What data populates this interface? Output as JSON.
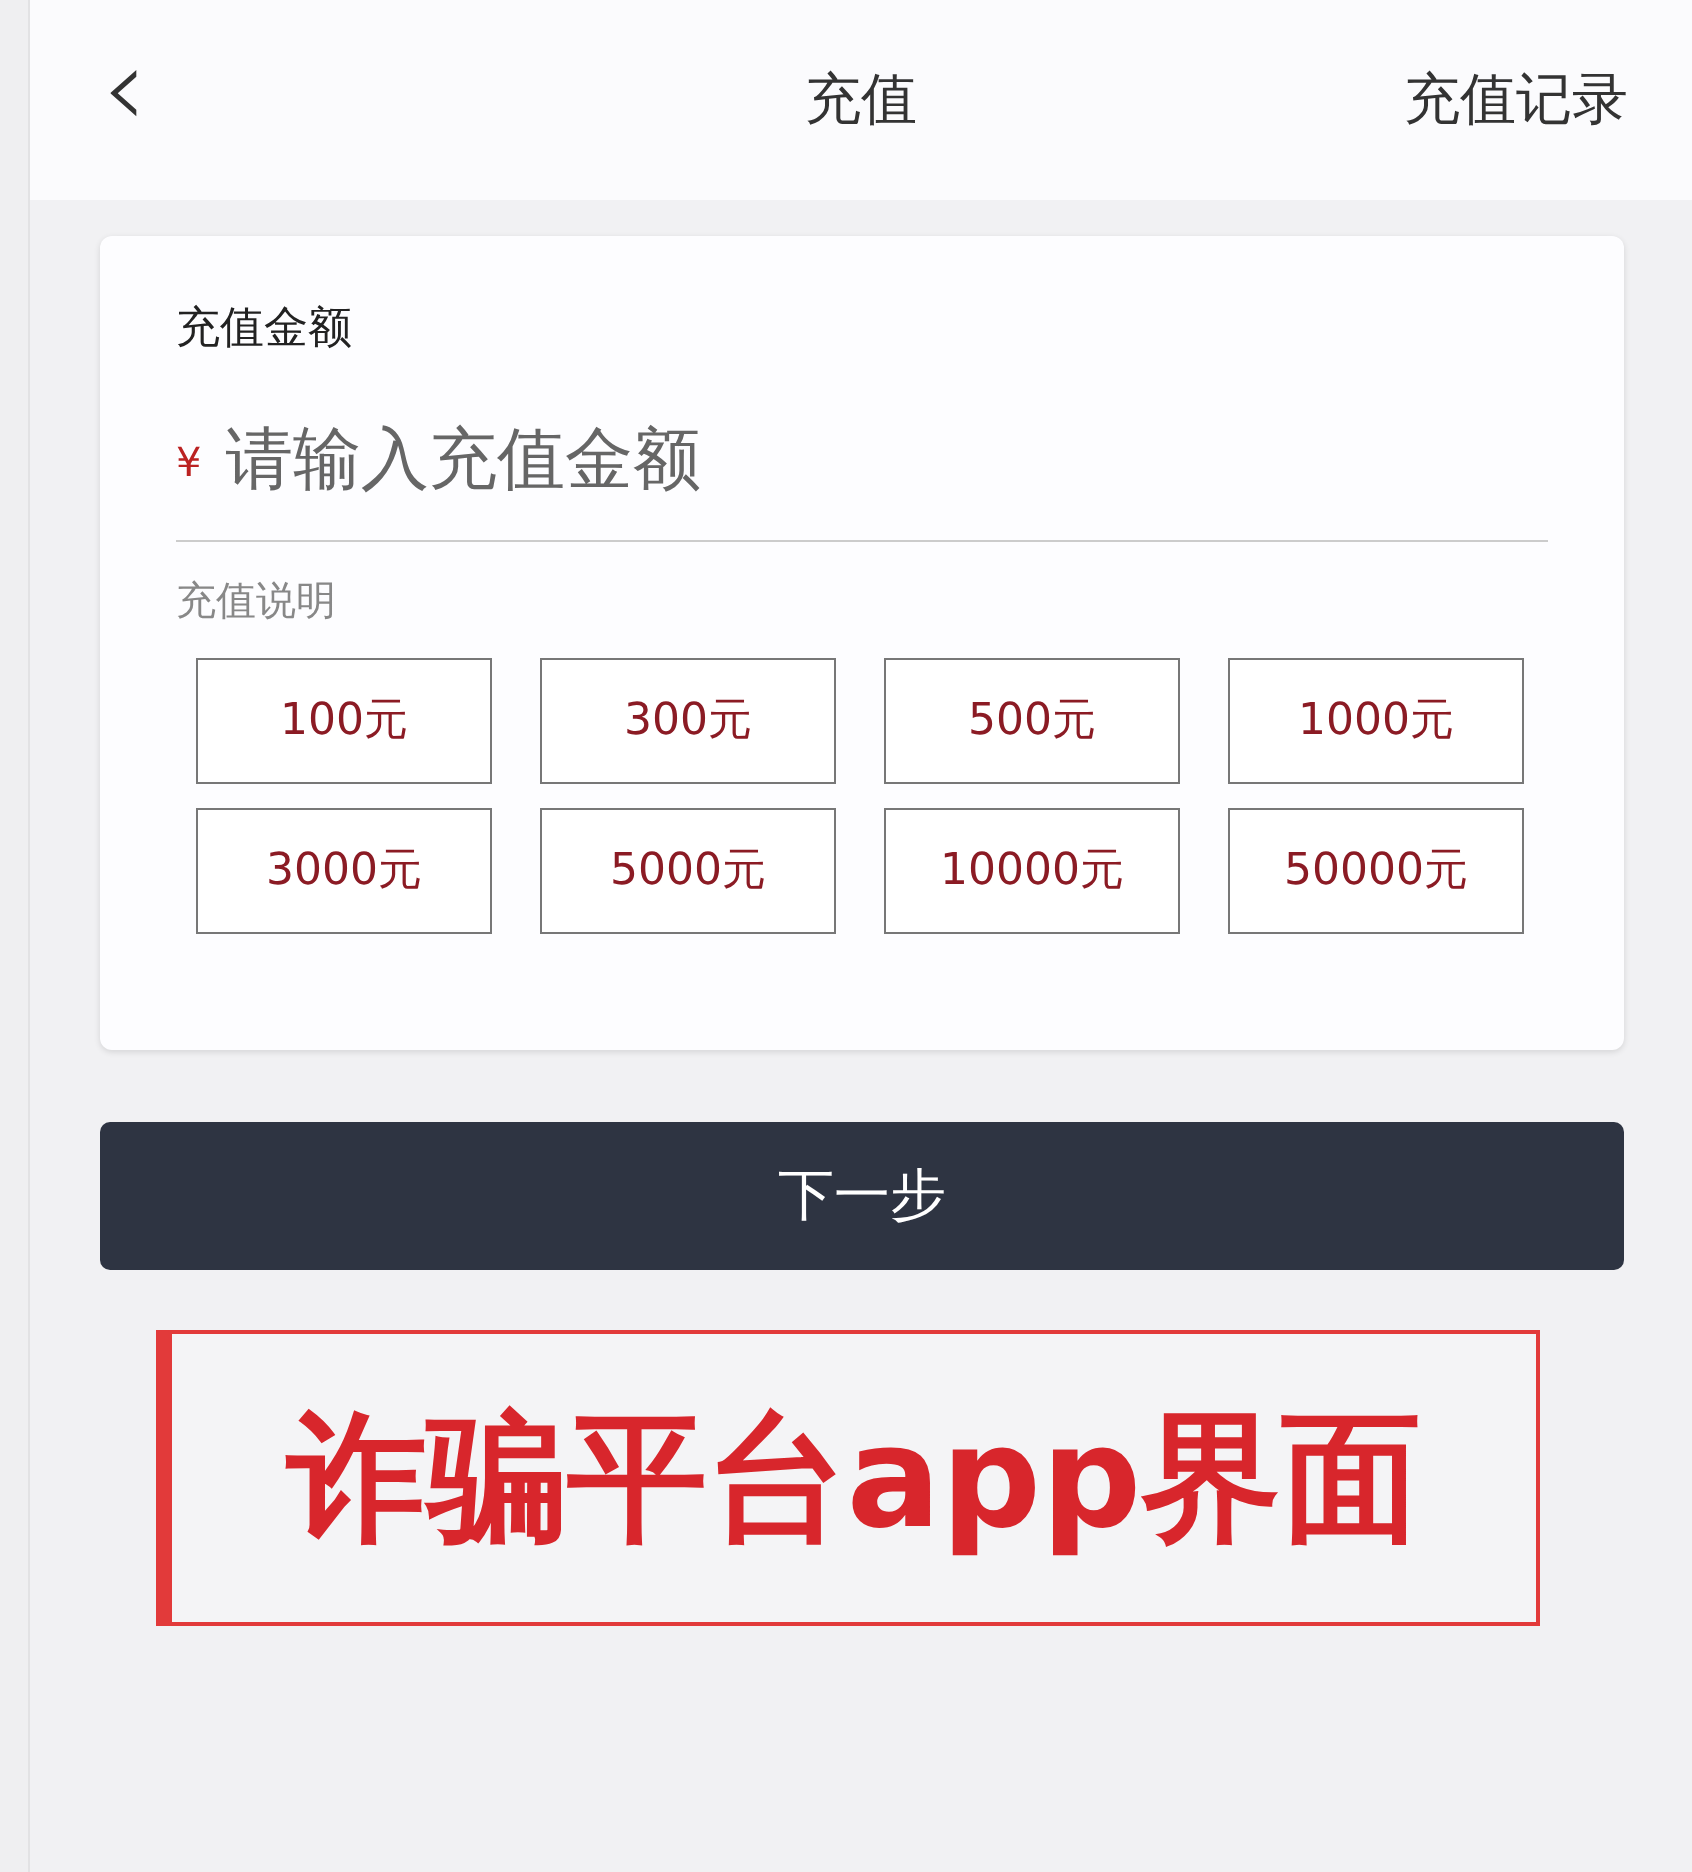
{
  "header": {
    "back_icon": "‹",
    "title": "充值",
    "action": "充值记录"
  },
  "card": {
    "amount_label": "充值金额",
    "currency": "¥",
    "amount_field": {
      "placeholder": "请输入充值金额"
    },
    "note_label": "充值说明",
    "amounts": [
      "100元",
      "300元",
      "500元",
      "1000元",
      "3000元",
      "5000元",
      "10000元",
      "50000元"
    ]
  },
  "next_button": "下一步",
  "annotation": "诈骗平台app界面"
}
